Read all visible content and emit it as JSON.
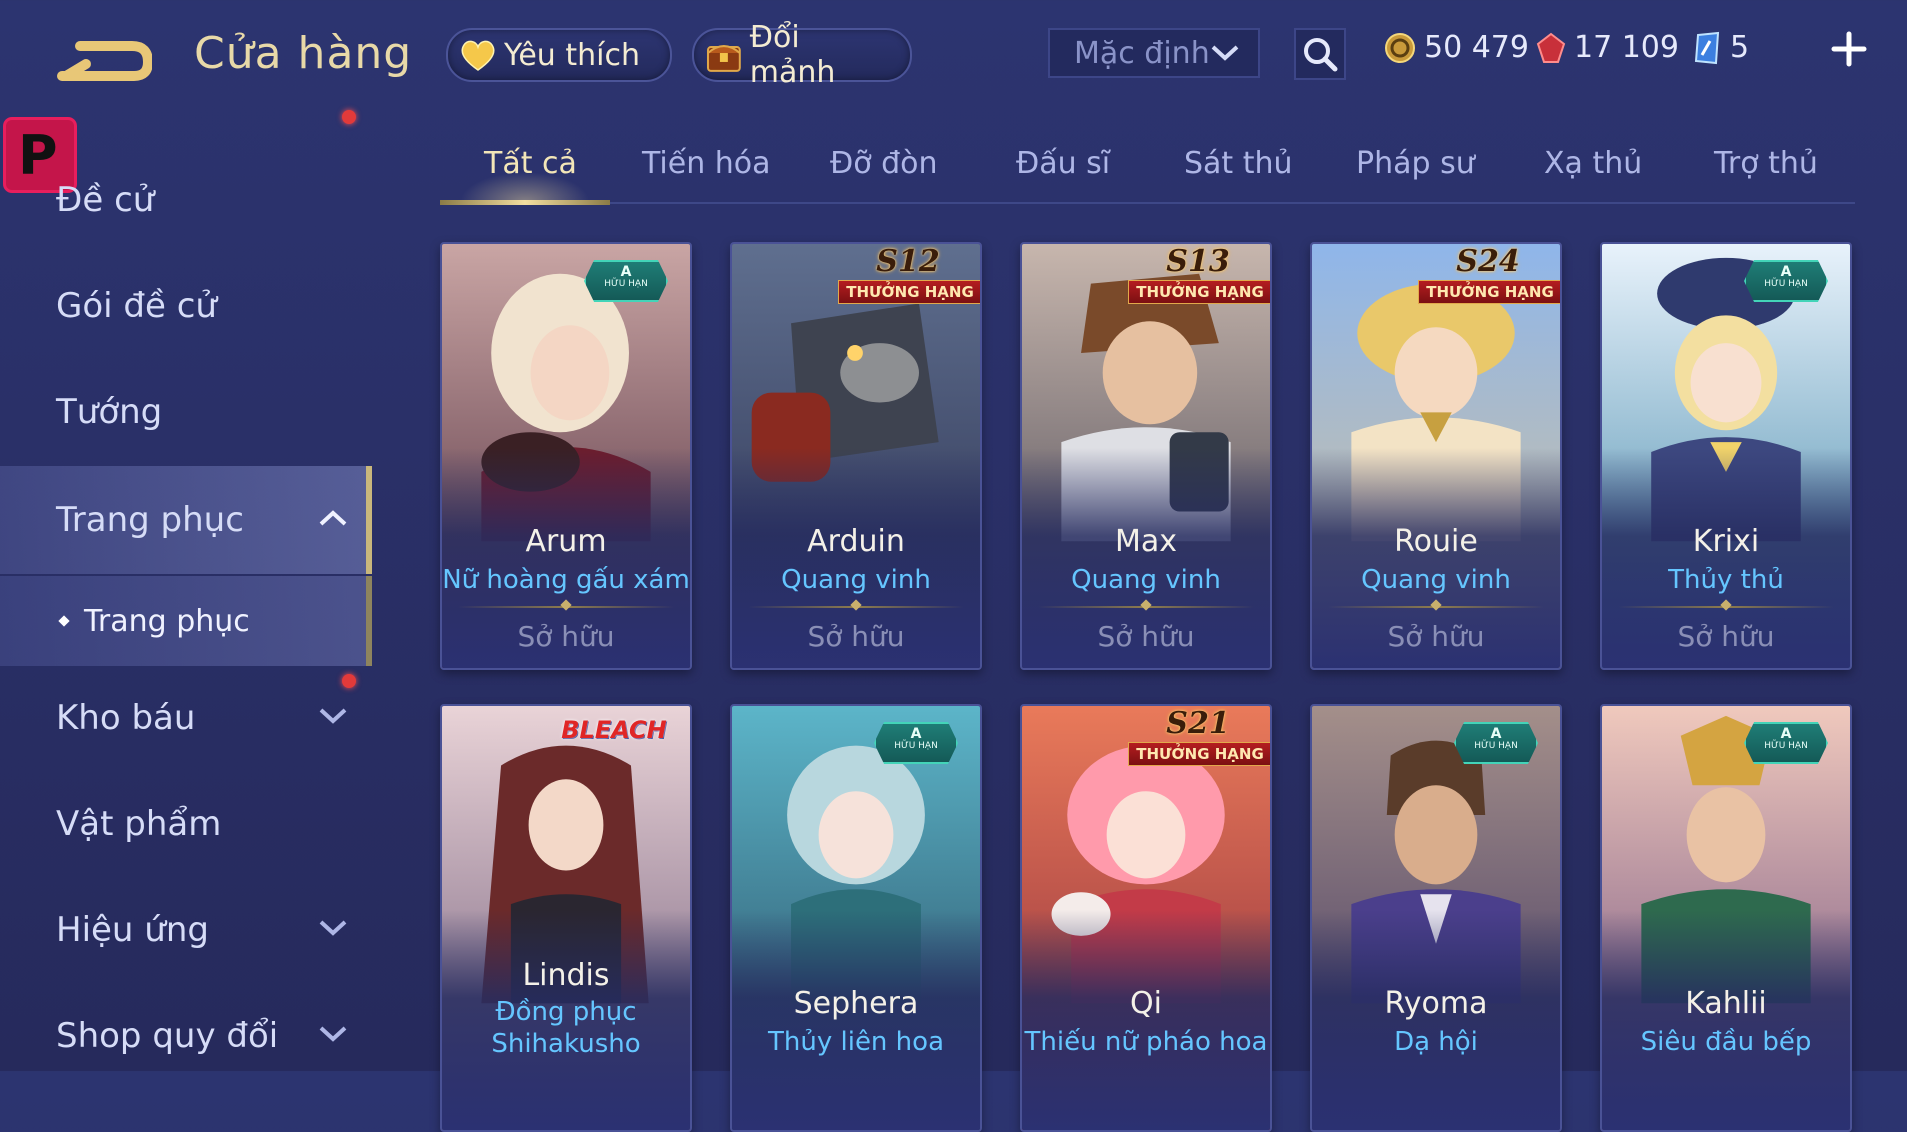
{
  "header": {
    "title": "Cửa hàng",
    "favorite_label": "Yêu thích",
    "shard_label": "Đổi mảnh",
    "sort_value": "Mặc định",
    "currencies": {
      "gold": "50 479",
      "ruby": "17 109",
      "token": "5"
    }
  },
  "sidebar": {
    "items": [
      {
        "label": "Đề cử"
      },
      {
        "label": "Gói đề cử"
      },
      {
        "label": "Tướng"
      },
      {
        "label": "Trang phục"
      },
      {
        "label": "Kho báu"
      },
      {
        "label": "Vật phẩm"
      },
      {
        "label": "Hiệu ứng"
      },
      {
        "label": "Shop quy đổi"
      }
    ],
    "sub_item": "Trang phục",
    "badge_letter": "P"
  },
  "tabs": [
    "Tất cả",
    "Tiến hóa",
    "Đỡ đòn",
    "Đấu sĩ",
    "Sát thủ",
    "Pháp sư",
    "Xạ thủ",
    "Trợ thủ"
  ],
  "badges": {
    "a_letter": "A",
    "a_text": "HỮU HẠN",
    "rank_text": "THƯỞNG HẠNG",
    "bleach": "BLEACH"
  },
  "cards": [
    {
      "hero": "Arum",
      "skin": "Nữ hoàng gấu xám",
      "status": "Sở hữu",
      "badge": "A"
    },
    {
      "hero": "Arduin",
      "skin": "Quang vinh",
      "status": "Sở hữu",
      "badge": "S12"
    },
    {
      "hero": "Max",
      "skin": "Quang vinh",
      "status": "Sở hữu",
      "badge": "S13"
    },
    {
      "hero": "Rouie",
      "skin": "Quang vinh",
      "status": "Sở hữu",
      "badge": "S24"
    },
    {
      "hero": "Krixi",
      "skin": "Thủy thủ",
      "status": "Sở hữu",
      "badge": "A"
    },
    {
      "hero": "Lindis",
      "skin": "Đồng phục Shihakusho",
      "badge": "BLEACH"
    },
    {
      "hero": "Sephera",
      "skin": "Thủy liên hoa",
      "badge": "A"
    },
    {
      "hero": "Qi",
      "skin": "Thiếu nữ pháo hoa",
      "badge": "S21"
    },
    {
      "hero": "Ryoma",
      "skin": "Dạ hội",
      "badge": "A"
    },
    {
      "hero": "Kahlii",
      "skin": "Siêu đầu bếp",
      "badge": "A"
    }
  ],
  "colors": {
    "background": "#2a3068",
    "gold_text": "#e8d9a8",
    "skin_text": "#65c6ff",
    "notification": "#e23a3a"
  }
}
